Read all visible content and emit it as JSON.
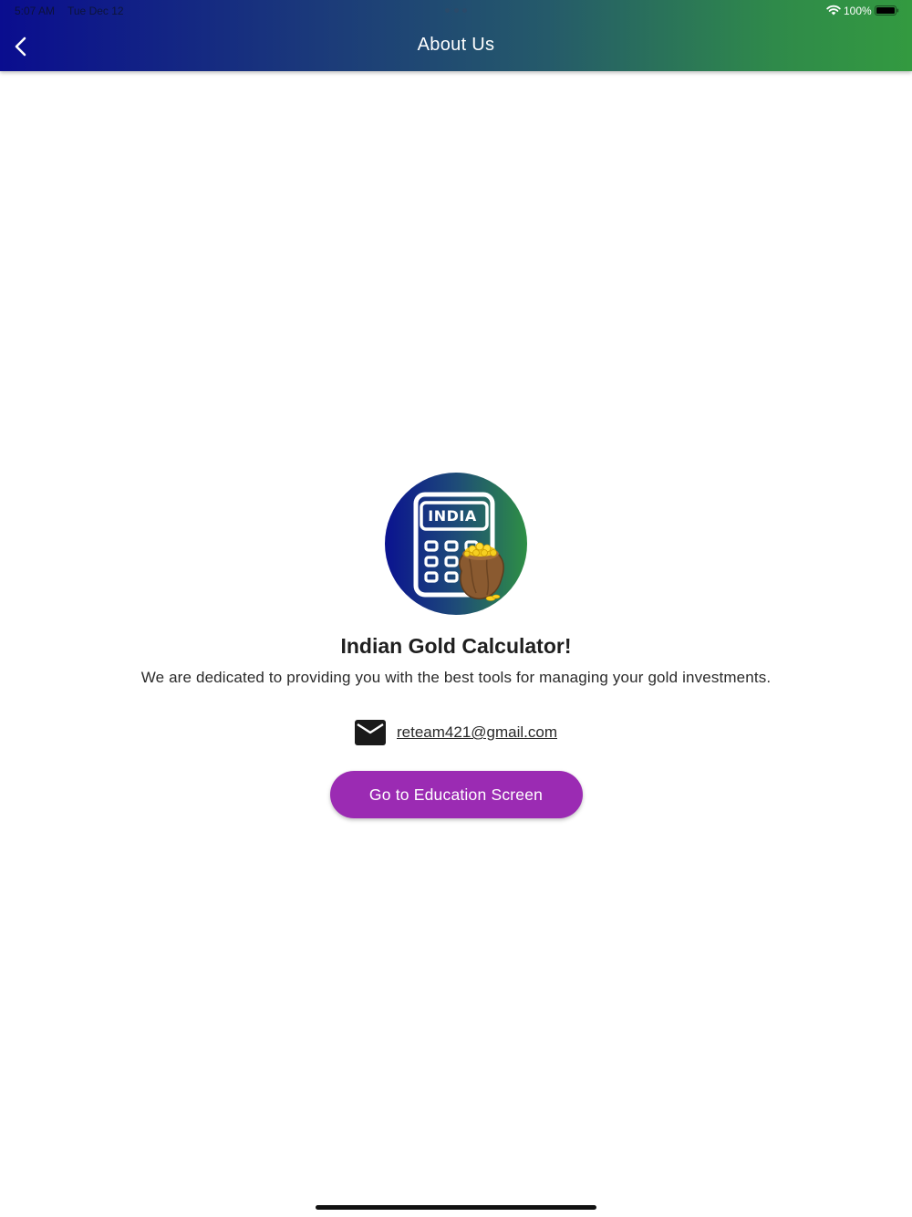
{
  "status_bar": {
    "time": "5:07 AM",
    "date": "Tue Dec 12",
    "battery_percent": "100%",
    "icons": [
      "wifi-icon",
      "battery-icon"
    ]
  },
  "app_bar": {
    "title": "About Us",
    "back_icon": "chevron-left-icon",
    "gradient_start": "#0a0d8f",
    "gradient_end": "#339a40"
  },
  "logo": {
    "badge_text": "INDIA",
    "icon": "calculator-with-gold-bag-icon"
  },
  "about": {
    "app_name": "Indian Gold Calculator!",
    "tagline": "We are dedicated to providing you with the best tools for managing your gold investments."
  },
  "contact": {
    "icon": "mail-icon",
    "email": "reteam421@gmail.com"
  },
  "actions": {
    "education_button_label": "Go to Education Screen",
    "button_color": "#9b2bb3"
  }
}
